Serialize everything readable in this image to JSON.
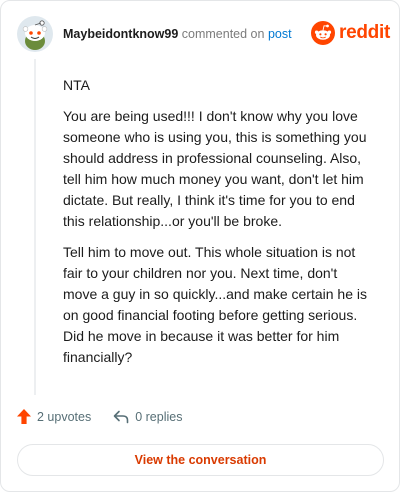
{
  "header": {
    "username": "Maybeidontknow99",
    "commented_on": "commented on",
    "post_link": "post",
    "brand": "reddit"
  },
  "comment": {
    "paragraphs": [
      "NTA",
      "You are being used!!! I don't know why you love someone who is using you, this is something you should address in professional counseling. Also, tell him how much money you want, don't let him dictate. But really, I think it's time for you to end this relationship...or you'll be broke.",
      "Tell him to move out. This whole situation is not fair to your children nor you. Next time, don't move a guy in so quickly...and make certain he is on good financial footing before getting serious. Did he move in because it was better for him financially?"
    ]
  },
  "footer": {
    "upvotes": "2 upvotes",
    "replies": "0 replies",
    "view_conversation": "View the conversation"
  },
  "colors": {
    "brand": "#ff4500",
    "link": "#0079d3",
    "upvote": "#ff4500",
    "button_text": "#d93a00"
  },
  "icons": {
    "avatar": "snoo-avatar",
    "logo": "reddit-snoo-icon",
    "upvote": "upvote-arrow-icon",
    "reply": "reply-arrow-icon"
  }
}
